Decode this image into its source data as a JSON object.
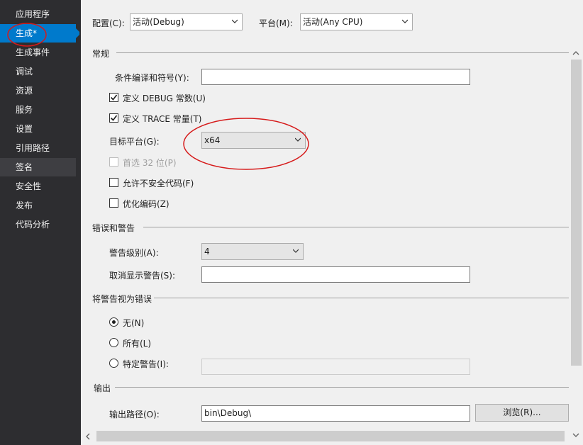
{
  "sidebar": {
    "items": [
      {
        "label": "应用程序"
      },
      {
        "label": "生成*"
      },
      {
        "label": "生成事件"
      },
      {
        "label": "调试"
      },
      {
        "label": "资源"
      },
      {
        "label": "服务"
      },
      {
        "label": "设置"
      },
      {
        "label": "引用路径"
      },
      {
        "label": "签名"
      },
      {
        "label": "安全性"
      },
      {
        "label": "发布"
      },
      {
        "label": "代码分析"
      }
    ],
    "active_index": 1
  },
  "toolbar": {
    "config_label": "配置(C):",
    "config_value": "活动(Debug)",
    "platform_label": "平台(M):",
    "platform_value": "活动(Any CPU)"
  },
  "general": {
    "title": "常规",
    "conditional_symbols_label": "条件编译和符号(Y):",
    "conditional_symbols_value": "",
    "define_debug_label": "定义 DEBUG 常数(U)",
    "define_debug_checked": true,
    "define_trace_label": "定义 TRACE 常量(T)",
    "define_trace_checked": true,
    "platform_target_label": "目标平台(G):",
    "platform_target_value": "x64",
    "prefer32_label": "首选 32 位(P)",
    "prefer32_checked": false,
    "unsafe_label": "允许不安全代码(F)",
    "unsafe_checked": false,
    "optimize_label": "优化编码(Z)",
    "optimize_checked": false
  },
  "errors": {
    "title": "错误和警告",
    "warning_level_label": "警告级别(A):",
    "warning_level_value": "4",
    "suppress_label": "取消显示警告(S):",
    "suppress_value": ""
  },
  "treat_warnings": {
    "title": "将警告视为错误",
    "none_label": "无(N)",
    "all_label": "所有(L)",
    "specific_label": "特定警告(I):",
    "selected": "none",
    "specific_value": ""
  },
  "output": {
    "title": "输出",
    "path_label": "输出路径(O):",
    "path_value": "bin\\Debug\\",
    "browse_label": "浏览(R)..."
  },
  "colors": {
    "sidebar_bg": "#2d2d30",
    "accent": "#007acc",
    "annotation": "#d61a1a"
  }
}
